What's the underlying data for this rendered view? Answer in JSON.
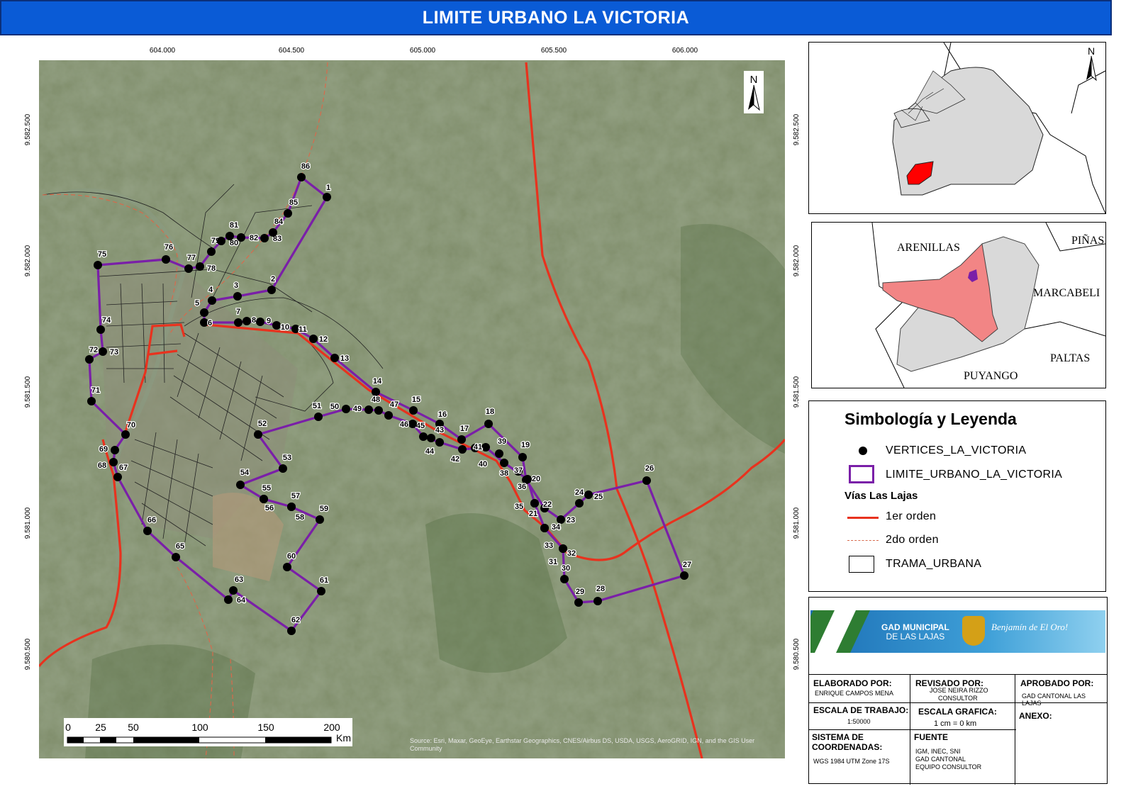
{
  "title": "LIMITE URBANO LA VICTORIA",
  "grid": {
    "x_labels": [
      "604.000",
      "604.500",
      "605.000",
      "605.500",
      "606.000"
    ],
    "y_labels": [
      "9.582.500",
      "9.582.000",
      "9.581.500",
      "9.581.000",
      "9.580.500"
    ]
  },
  "north_label": "N",
  "scalebar": {
    "ticks": [
      "0",
      "25",
      "50",
      "100",
      "150",
      "200"
    ],
    "unit": "Km"
  },
  "attribution": "Source: Esri, Maxar, GeoEye, Earthstar Geographics, CNES/Airbus DS, USDA, USGS, AeroGRID, IGN, and the GIS User Community",
  "vertices": [
    "1",
    "2",
    "3",
    "4",
    "5",
    "6",
    "7",
    "8",
    "9",
    "10",
    "11",
    "12",
    "13",
    "14",
    "15",
    "16",
    "17",
    "18",
    "19",
    "20",
    "21",
    "22",
    "23",
    "24",
    "25",
    "26",
    "27",
    "28",
    "29",
    "30",
    "31",
    "32",
    "33",
    "34",
    "35",
    "36",
    "37",
    "38",
    "39",
    "40",
    "41",
    "42",
    "43",
    "44",
    "45",
    "46",
    "47",
    "48",
    "49",
    "50",
    "51",
    "52",
    "53",
    "54",
    "55",
    "56",
    "57",
    "58",
    "59",
    "60",
    "61",
    "62",
    "63",
    "64",
    "65",
    "66",
    "67",
    "68",
    "69",
    "70",
    "71",
    "72",
    "73",
    "74",
    "75",
    "76",
    "77",
    "78",
    "79",
    "80",
    "81",
    "82",
    "83",
    "84",
    "85",
    "86"
  ],
  "locator2": {
    "regions": [
      "ARENILLAS",
      "PIÑAS",
      "MARCABELI",
      "PALTAS",
      "PUYANGO"
    ]
  },
  "legend": {
    "title": "Simbología y Leyenda",
    "vertices": "VERTICES_LA_VICTORIA",
    "limit": "LIMITE_URBANO_LA_VICTORIA",
    "roads_title": "Vías Las Lajas",
    "road1": "1er orden",
    "road2": "2do orden",
    "urban": "TRAMA_URBANA"
  },
  "logo": {
    "line1": "GAD MUNICIPAL",
    "line2": "DE LAS LAJAS",
    "slogan": "Benjamín de El Oro!"
  },
  "info": {
    "elaborado_label": "ELABORADO POR:",
    "elaborado_value": "ENRIQUE CAMPOS MENA",
    "revisado_label": "REVISADO POR:",
    "revisado_value1": "JOSE NEIRA RIZZO",
    "revisado_value2": "CONSULTOR",
    "aprobado_label": "APROBADO POR:",
    "aprobado_value": "GAD CANTONAL LAS LAJAS",
    "escala_trabajo_label": "ESCALA DE TRABAJO:",
    "escala_trabajo_value": "1:50000",
    "escala_grafica_label": "ESCALA GRAFICA:",
    "escala_grafica_value": "1 cm = 0 km",
    "anexo_label": "ANEXO:",
    "sistema_label1": "SISTEMA DE",
    "sistema_label2": "COORDENADAS:",
    "sistema_value": "WGS 1984 UTM Zone 17S",
    "fuente_label": "FUENTE",
    "fuente_1": "IGM, INEC, SNI",
    "fuente_2": "GAD CANTONAL",
    "fuente_3": "EQUIPO CONSULTOR"
  },
  "colors": {
    "title_bg": "#0a5bd6",
    "boundary": "#7a1fa8",
    "road_primary": "#e8321e",
    "road_secondary": "#e07050",
    "imagery": "#6f7d5e",
    "locator_fill": "#d9d9d9",
    "highlight_red": "#ff0000",
    "highlight_pink": "#f28585"
  }
}
